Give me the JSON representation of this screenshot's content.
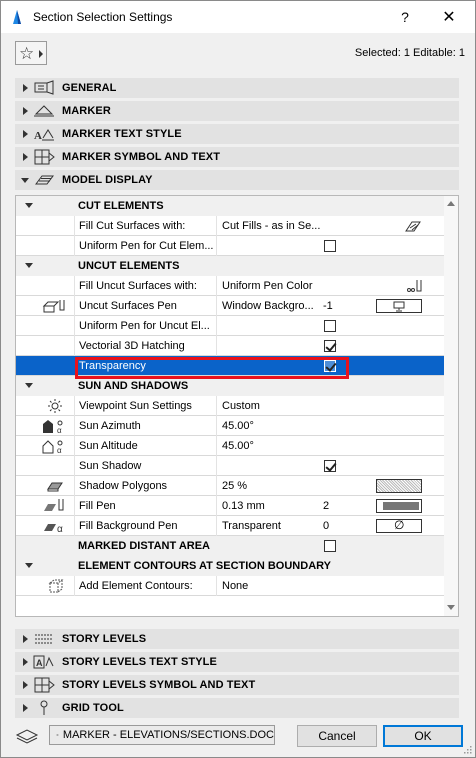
{
  "window": {
    "title": "Section Selection Settings",
    "help_label": "?",
    "close_label": "✕",
    "accent_color": "#0a63c9",
    "highlight_frame_color": "#e8121c"
  },
  "toolbar": {
    "favorites_icon": "star-icon",
    "selected_info": "Selected: 1 Editable: 1"
  },
  "panels_top": [
    {
      "label": "GENERAL",
      "state": "collapsed",
      "icon": "general-settings-icon"
    },
    {
      "label": "MARKER",
      "state": "collapsed",
      "icon": "marker-icon"
    },
    {
      "label": "MARKER TEXT STYLE",
      "state": "collapsed",
      "icon": "marker-text-style-icon"
    },
    {
      "label": "MARKER SYMBOL AND TEXT",
      "state": "collapsed",
      "icon": "marker-symbol-icon"
    },
    {
      "label": "MODEL DISPLAY",
      "state": "expanded",
      "icon": "model-display-icon"
    }
  ],
  "model_display": {
    "cut_elements": {
      "heading": "CUT ELEMENTS",
      "fill_cut_label": "Fill Cut Surfaces with:",
      "fill_cut_value": "Cut Fills - as in Se...",
      "uniform_pen_cut_label": "Uniform Pen for Cut Elem...",
      "uniform_pen_cut_checked": false
    },
    "uncut_elements": {
      "heading": "UNCUT ELEMENTS",
      "fill_uncut_label": "Fill Uncut Surfaces with:",
      "fill_uncut_value": "Uniform Pen Color",
      "uncut_pen_label": "Uncut Surfaces Pen",
      "uncut_pen_value": "Window Backgro...",
      "uncut_pen_number": "-1",
      "uniform_pen_uncut_label": "Uniform Pen for Uncut El...",
      "uniform_pen_uncut_checked": false,
      "vectorial_label": "Vectorial 3D Hatching",
      "vectorial_checked": true,
      "transparency_label": "Transparency",
      "transparency_checked": true
    },
    "sun_and_shadows": {
      "heading": "SUN AND SHADOWS",
      "viewpoint_label": "Viewpoint Sun Settings",
      "viewpoint_value": "Custom",
      "azimuth_label": "Sun Azimuth",
      "azimuth_value": "45.00°",
      "altitude_label": "Sun Altitude",
      "altitude_value": "45.00°",
      "shadow_label": "Sun Shadow",
      "shadow_checked": true,
      "shadow_polygons_label": "Shadow Polygons",
      "shadow_polygons_value": "25 %",
      "fill_pen_label": "Fill Pen",
      "fill_pen_value": "0.13 mm",
      "fill_pen_number": "2",
      "fill_bg_pen_label": "Fill Background Pen",
      "fill_bg_pen_value": "Transparent",
      "fill_bg_pen_number": "0"
    },
    "marked_distant": {
      "heading": "MARKED DISTANT AREA",
      "checked": false
    },
    "contours": {
      "heading": "ELEMENT CONTOURS AT SECTION BOUNDARY",
      "add_label": "Add Element Contours:",
      "add_value": "None"
    }
  },
  "panels_bottom": [
    {
      "label": "STORY LEVELS",
      "state": "collapsed",
      "icon": "story-levels-icon"
    },
    {
      "label": "STORY LEVELS TEXT STYLE",
      "state": "collapsed",
      "icon": "story-levels-text-icon"
    },
    {
      "label": "STORY LEVELS SYMBOL AND TEXT",
      "state": "collapsed",
      "icon": "story-levels-symbol-icon"
    },
    {
      "label": "GRID TOOL",
      "state": "collapsed",
      "icon": "grid-tool-icon"
    }
  ],
  "footer": {
    "favorite_value": "MARKER - ELEVATIONS/SECTIONS.DOC",
    "cancel_label": "Cancel",
    "ok_label": "OK"
  }
}
